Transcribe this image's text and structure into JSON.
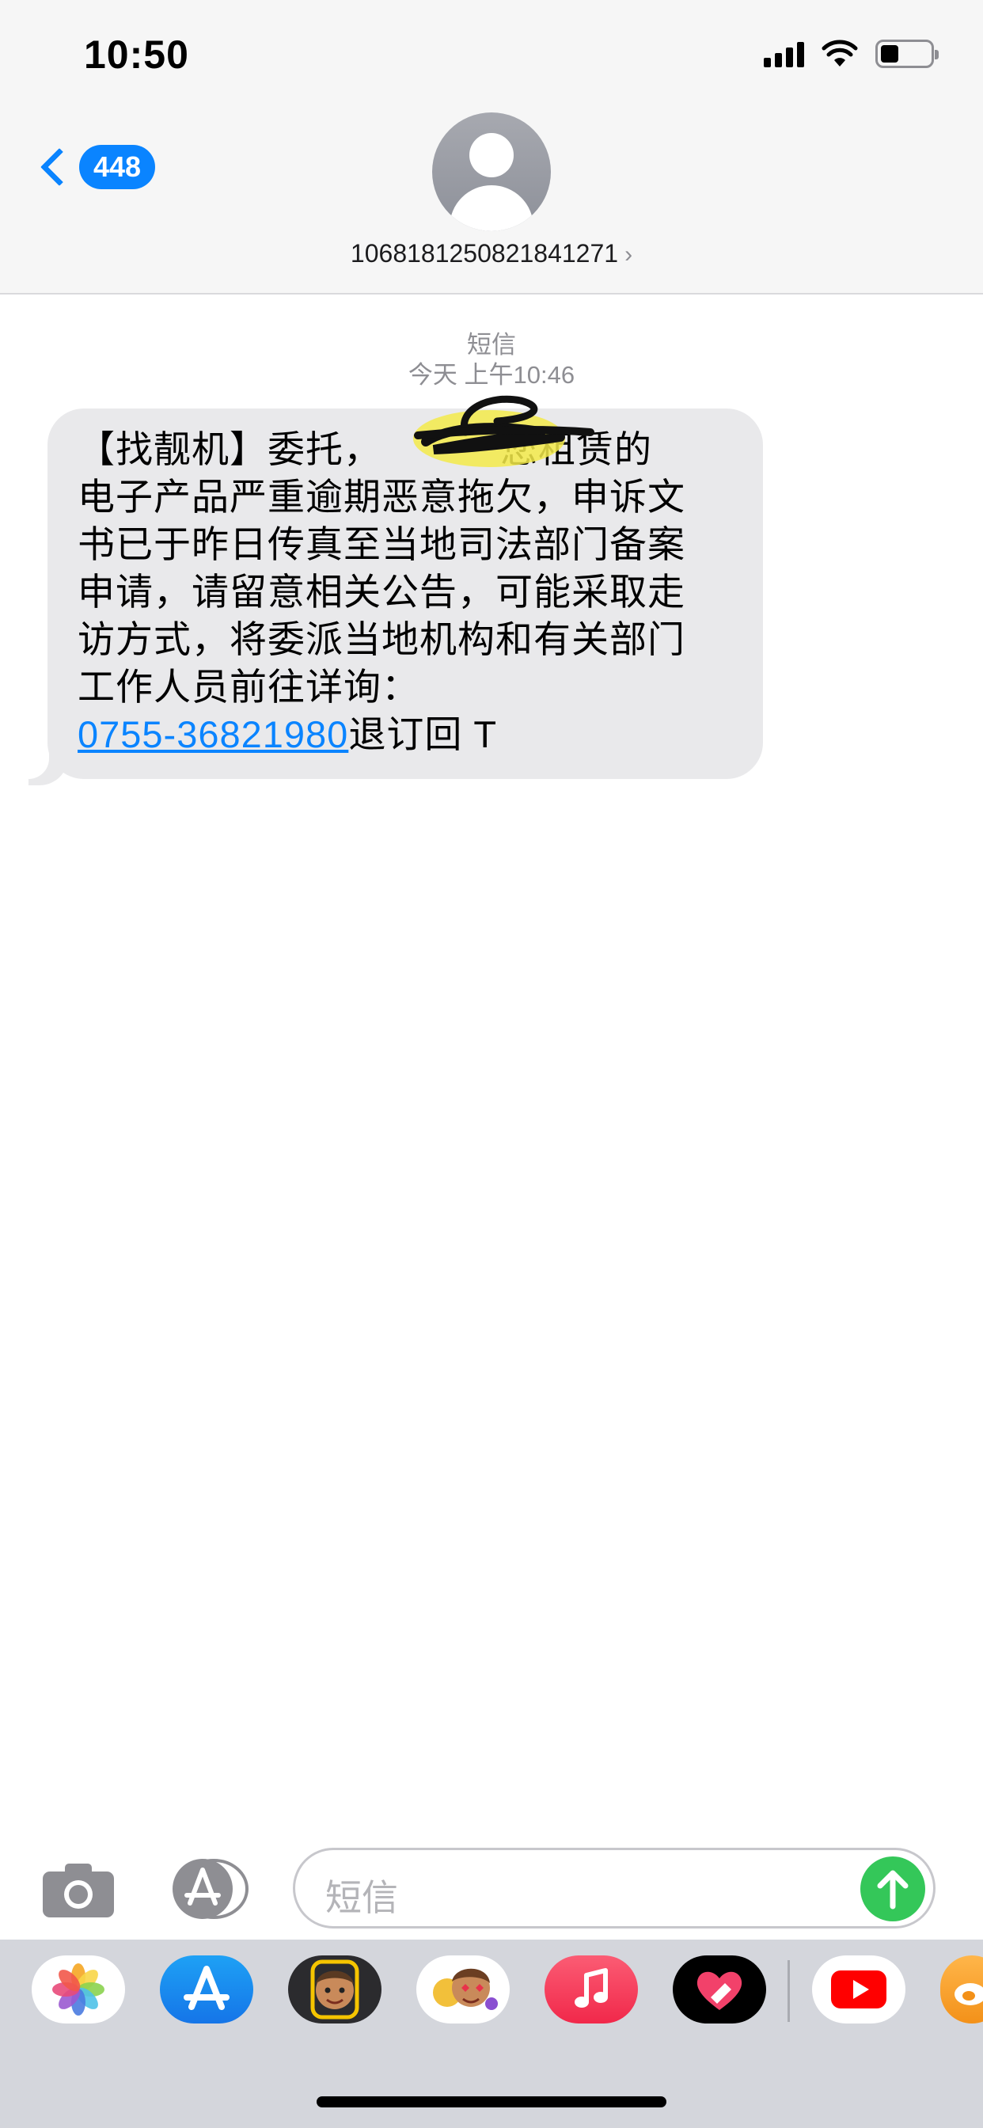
{
  "status_bar": {
    "time": "10:50"
  },
  "nav": {
    "back_count": "448",
    "contact_number": "1068181250821841271"
  },
  "conversation": {
    "service_label": "短信",
    "timestamp": "今天 上午10:46",
    "message": {
      "line1": "【找靓机】委托，",
      "line1_after": "您租赁的",
      "line2": "电子产品严重逾期恶意拖欠，申诉文",
      "line3": "书已于昨日传真至当地司法部门备案",
      "line4": "申请，请留意相关公告，可能采取走",
      "line5": "访方式，将委派当地机构和有关部门",
      "line6": "工作人员前往详询：",
      "phone_link": "0755-36821980",
      "suffix": "退订回 T"
    }
  },
  "input_bar": {
    "placeholder": "短信"
  },
  "app_drawer": {
    "apps": [
      "photos-icon",
      "app-store-icon",
      "memoji-icon",
      "animoji-stickers-icon",
      "music-icon",
      "digital-touch-icon",
      "youtube-icon",
      "weibo-icon"
    ]
  },
  "colors": {
    "accent": "#0a84ff",
    "send": "#34c759",
    "bubble": "#e9e9eb"
  }
}
